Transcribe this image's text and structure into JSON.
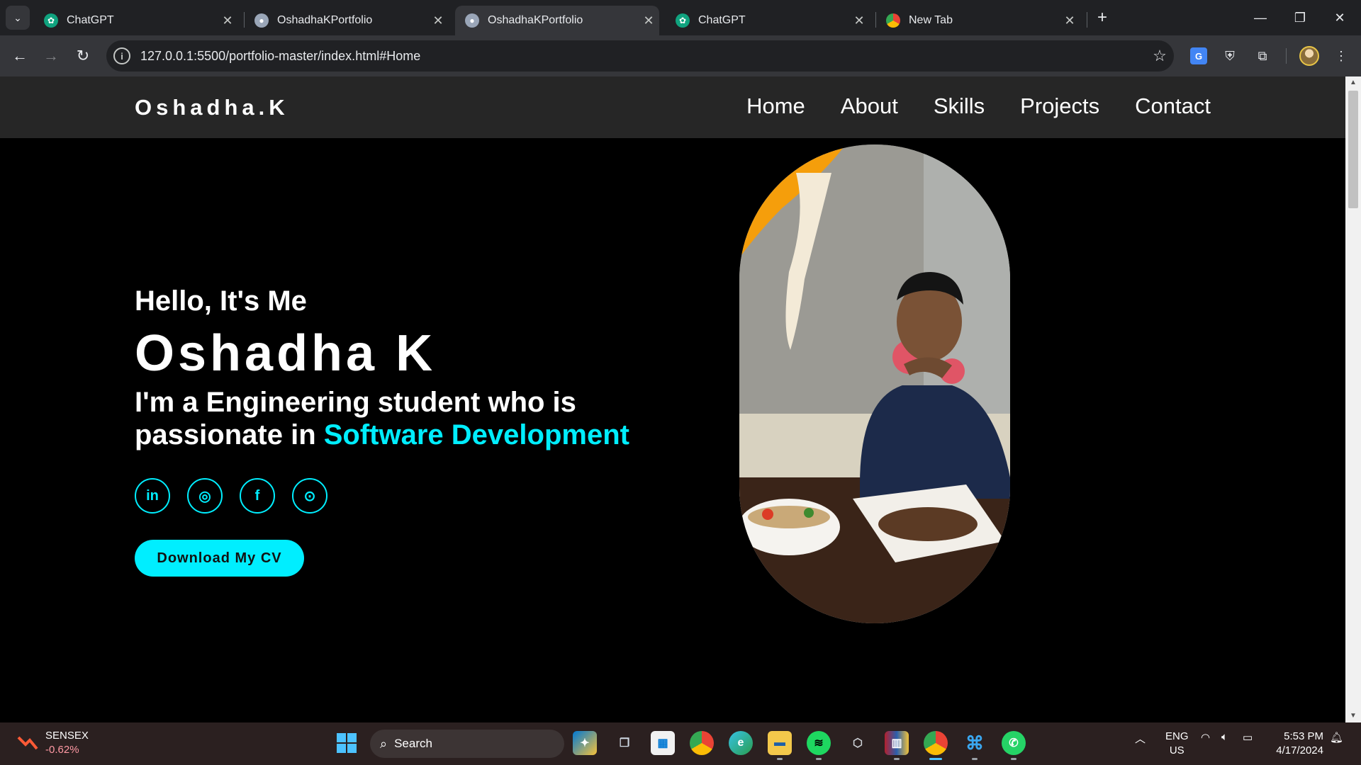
{
  "browser": {
    "tabs": [
      {
        "title": "ChatGPT",
        "icon": "chatgpt-icon",
        "active": false
      },
      {
        "title": "OshadhaKPortfolio",
        "icon": "avatar-icon",
        "active": false
      },
      {
        "title": "OshadhaKPortfolio",
        "icon": "avatar-icon",
        "active": true
      },
      {
        "title": "ChatGPT",
        "icon": "chatgpt-icon",
        "active": false
      },
      {
        "title": "New Tab",
        "icon": "chrome-icon",
        "active": false
      }
    ],
    "url": "127.0.0.1:5500/portfolio-master/index.html#Home"
  },
  "site": {
    "logo": "Oshadha.K",
    "nav": [
      "Home",
      "About",
      "Skills",
      "Projects",
      "Contact"
    ],
    "hero": {
      "greeting": "Hello, It's Me",
      "name": "Oshadha K",
      "tagline_prefix": "I'm a Engineering student who is passionate in ",
      "tagline_accent": "Software Development",
      "socials": [
        {
          "name": "linkedin-icon",
          "glyph": "in"
        },
        {
          "name": "instagram-icon",
          "glyph": "◎"
        },
        {
          "name": "facebook-icon",
          "glyph": "f"
        },
        {
          "name": "github-icon",
          "glyph": "⊙"
        }
      ],
      "cv_button": "Download My CV"
    },
    "accent_color": "#00eeff"
  },
  "taskbar": {
    "ticker_name": "SENSEX",
    "ticker_change": "-0.62%",
    "search_placeholder": "Search",
    "language": "ENG",
    "region": "US",
    "time": "5:53 PM",
    "date": "4/17/2024"
  }
}
